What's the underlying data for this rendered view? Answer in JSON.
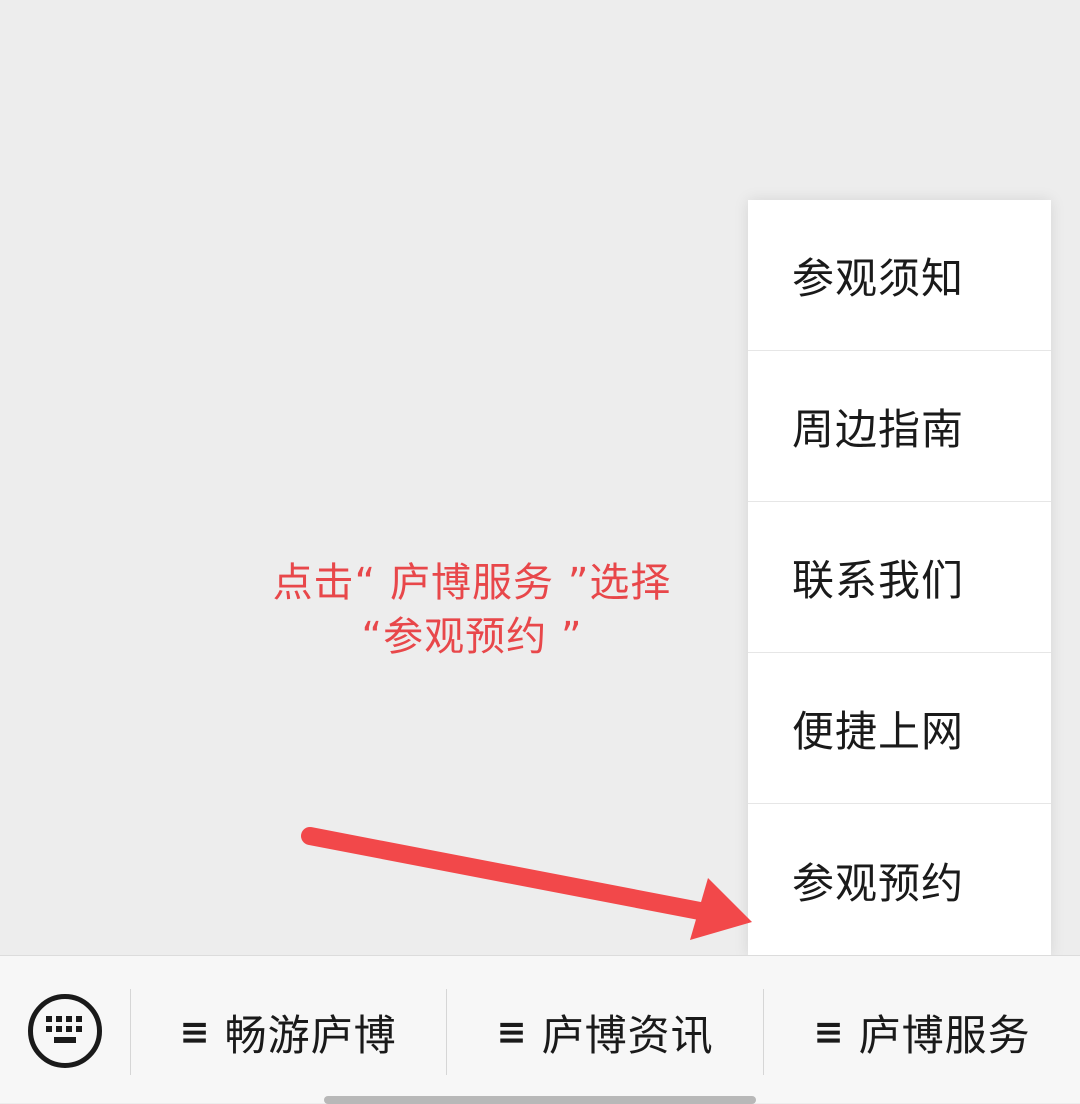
{
  "submenu": {
    "items": [
      {
        "label": "参观须知"
      },
      {
        "label": "周边指南"
      },
      {
        "label": "联系我们"
      },
      {
        "label": "便捷上网"
      },
      {
        "label": "参观预约"
      }
    ]
  },
  "annotation": {
    "line1": "点击“ 庐博服务 ”选择",
    "line2": "“参观预约 ”",
    "color": "#e8474a"
  },
  "menu_bar": {
    "keyboard_icon": "keyboard-icon",
    "menu_icon": "≡",
    "buttons": [
      {
        "label": "畅游庐博"
      },
      {
        "label": "庐博资讯"
      },
      {
        "label": "庐博服务"
      }
    ]
  }
}
